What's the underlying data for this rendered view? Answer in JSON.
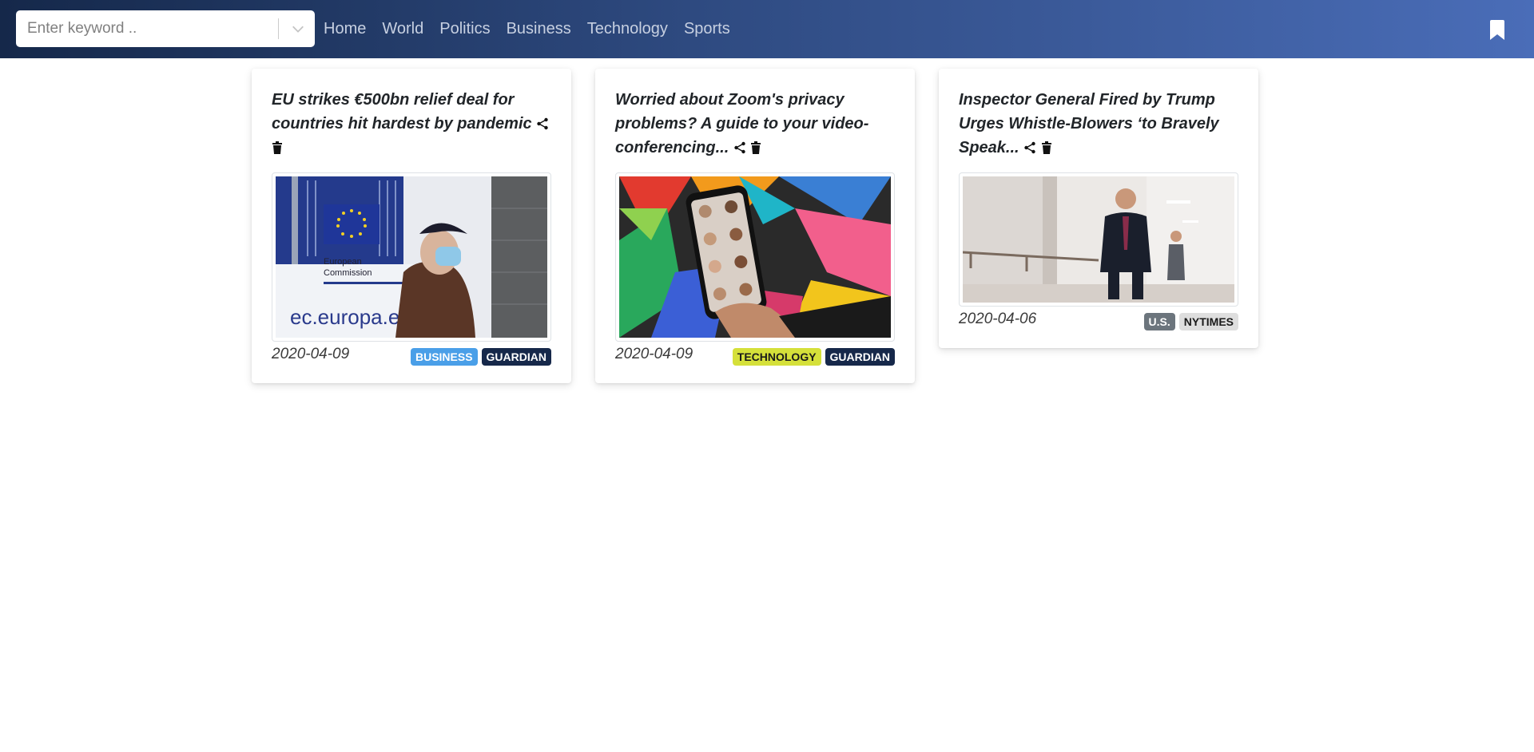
{
  "search": {
    "placeholder": "Enter keyword .."
  },
  "nav": {
    "links": [
      "Home",
      "World",
      "Politics",
      "Business",
      "Technology",
      "Sports"
    ]
  },
  "icons": {
    "dropdown": "chevron-down-icon",
    "bookmarks": "bookmark-icon",
    "share": "share-icon",
    "delete": "trash-icon"
  },
  "cards": [
    {
      "title": "EU strikes €500bn relief deal for countries hit hardest by pandemic",
      "date": "2020-04-09",
      "tags": [
        {
          "label": "BUSINESS",
          "bg": "#4a9fe8",
          "fg": "#ffffff"
        },
        {
          "label": "GUARDIAN",
          "bg": "#16284a",
          "fg": "#ffffff"
        }
      ]
    },
    {
      "title": "Worried about Zoom's privacy problems? A guide to your video-conferencing...",
      "date": "2020-04-09",
      "tags": [
        {
          "label": "TECHNOLOGY",
          "bg": "#d5e03a",
          "fg": "#1a1a1a"
        },
        {
          "label": "GUARDIAN",
          "bg": "#16284a",
          "fg": "#ffffff"
        }
      ]
    },
    {
      "title": "Inspector General Fired by Trump Urges Whistle-Blowers ‘to Bravely Speak...",
      "date": "2020-04-06",
      "tags": [
        {
          "label": "U.S.",
          "bg": "#6c757d",
          "fg": "#ffffff"
        },
        {
          "label": "NYTIMES",
          "bg": "#dedede",
          "fg": "#1a1a1a"
        }
      ]
    }
  ]
}
